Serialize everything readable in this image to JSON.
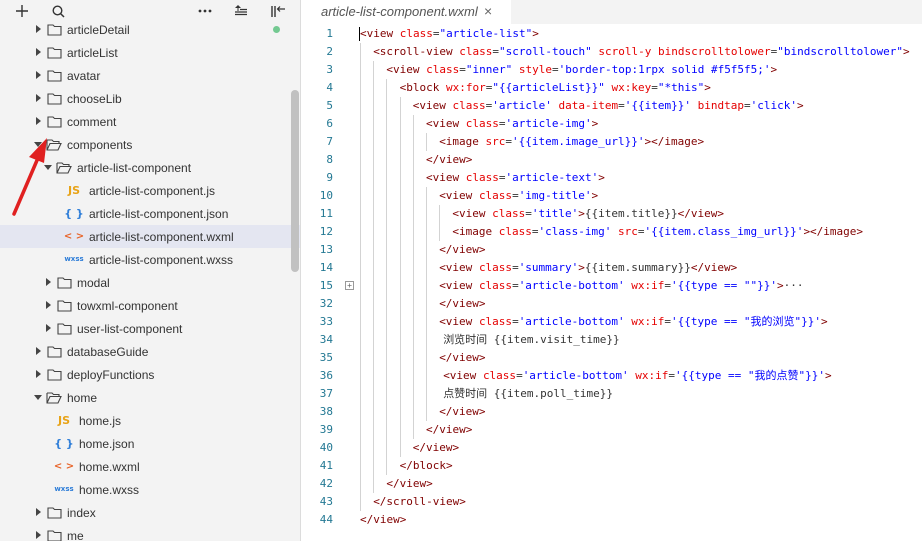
{
  "toolbar": {
    "add": "+",
    "search": "search-icon",
    "more": "···",
    "collapse": "collapse-icon",
    "split": "split-icon"
  },
  "tree": [
    {
      "label": "articleDetail",
      "type": "folder",
      "open": false,
      "depth": 0,
      "dot": true
    },
    {
      "label": "articleList",
      "type": "folder",
      "open": false,
      "depth": 0
    },
    {
      "label": "avatar",
      "type": "folder",
      "open": false,
      "depth": 0
    },
    {
      "label": "chooseLib",
      "type": "folder",
      "open": false,
      "depth": 0
    },
    {
      "label": "comment",
      "type": "folder",
      "open": false,
      "depth": 0
    },
    {
      "label": "components",
      "type": "folder",
      "open": true,
      "depth": 0
    },
    {
      "label": "article-list-component",
      "type": "folder",
      "open": true,
      "depth": 1
    },
    {
      "label": "article-list-component.js",
      "type": "js",
      "depth": 2,
      "icon": "JS"
    },
    {
      "label": "article-list-component.json",
      "type": "json",
      "depth": 2,
      "icon": "{ }"
    },
    {
      "label": "article-list-component.wxml",
      "type": "wxml",
      "depth": 2,
      "icon": "< >",
      "selected": true
    },
    {
      "label": "article-list-component.wxss",
      "type": "wxss",
      "depth": 2,
      "icon": "wxss"
    },
    {
      "label": "modal",
      "type": "folder",
      "open": false,
      "depth": 1
    },
    {
      "label": "towxml-component",
      "type": "folder",
      "open": false,
      "depth": 1
    },
    {
      "label": "user-list-component",
      "type": "folder",
      "open": false,
      "depth": 1
    },
    {
      "label": "databaseGuide",
      "type": "folder",
      "open": false,
      "depth": 0
    },
    {
      "label": "deployFunctions",
      "type": "folder",
      "open": false,
      "depth": 0
    },
    {
      "label": "home",
      "type": "folder",
      "open": true,
      "depth": 0
    },
    {
      "label": "home.js",
      "type": "js",
      "depth": 1,
      "icon": "JS"
    },
    {
      "label": "home.json",
      "type": "json",
      "depth": 1,
      "icon": "{ }"
    },
    {
      "label": "home.wxml",
      "type": "wxml",
      "depth": 1,
      "icon": "< >"
    },
    {
      "label": "home.wxss",
      "type": "wxss",
      "depth": 1,
      "icon": "wxss"
    },
    {
      "label": "index",
      "type": "folder",
      "open": false,
      "depth": 0
    },
    {
      "label": "me",
      "type": "folder",
      "open": false,
      "depth": 0
    }
  ],
  "editor": {
    "tab_title": "article-list-component.wxml",
    "tab_close": "×",
    "lines": [
      {
        "n": "1",
        "indent": 0,
        "tokens": [
          [
            "t",
            "<view "
          ],
          [
            "a",
            "class"
          ],
          [
            "p",
            "="
          ],
          [
            "v",
            "\"article-list\""
          ],
          [
            "t",
            ">"
          ]
        ]
      },
      {
        "n": "2",
        "indent": 1,
        "tokens": [
          [
            "t",
            "<scroll-view "
          ],
          [
            "a",
            "class"
          ],
          [
            "p",
            "="
          ],
          [
            "v",
            "\"scroll-touch\""
          ],
          [
            "p",
            " "
          ],
          [
            "a",
            "scroll-y"
          ],
          [
            "p",
            " "
          ],
          [
            "a",
            "bindscrolltolower"
          ],
          [
            "p",
            "="
          ],
          [
            "v",
            "\"bindscrolltolower\""
          ],
          [
            "t",
            ">"
          ]
        ]
      },
      {
        "n": "3",
        "indent": 2,
        "tokens": [
          [
            "t",
            "<view "
          ],
          [
            "a",
            "class"
          ],
          [
            "p",
            "="
          ],
          [
            "v",
            "\"inner\""
          ],
          [
            "p",
            " "
          ],
          [
            "a",
            "style"
          ],
          [
            "p",
            "="
          ],
          [
            "v",
            "'border-top:1rpx solid #f5f5f5;'"
          ],
          [
            "t",
            ">"
          ]
        ]
      },
      {
        "n": "4",
        "indent": 3,
        "tokens": [
          [
            "t",
            "<block "
          ],
          [
            "a",
            "wx:for"
          ],
          [
            "p",
            "="
          ],
          [
            "v",
            "\"{{articleList}}\""
          ],
          [
            "p",
            " "
          ],
          [
            "a",
            "wx:key"
          ],
          [
            "p",
            "="
          ],
          [
            "v",
            "\"*this\""
          ],
          [
            "t",
            ">"
          ]
        ]
      },
      {
        "n": "5",
        "indent": 4,
        "tokens": [
          [
            "t",
            "<view "
          ],
          [
            "a",
            "class"
          ],
          [
            "p",
            "="
          ],
          [
            "v",
            "'article'"
          ],
          [
            "p",
            " "
          ],
          [
            "a",
            "data-item"
          ],
          [
            "p",
            "="
          ],
          [
            "v",
            "'{{item}}'"
          ],
          [
            "p",
            " "
          ],
          [
            "a",
            "bindtap"
          ],
          [
            "p",
            "="
          ],
          [
            "v",
            "'click'"
          ],
          [
            "t",
            ">"
          ]
        ]
      },
      {
        "n": "6",
        "indent": 5,
        "tokens": [
          [
            "t",
            "<view "
          ],
          [
            "a",
            "class"
          ],
          [
            "p",
            "="
          ],
          [
            "v",
            "'article-img'"
          ],
          [
            "t",
            ">"
          ]
        ]
      },
      {
        "n": "7",
        "indent": 6,
        "tokens": [
          [
            "t",
            "<image "
          ],
          [
            "a",
            "src"
          ],
          [
            "p",
            "="
          ],
          [
            "v",
            "'{{item.image_url}}'"
          ],
          [
            "t",
            "></image>"
          ]
        ]
      },
      {
        "n": "8",
        "indent": 5,
        "tokens": [
          [
            "t",
            "</view>"
          ]
        ]
      },
      {
        "n": "9",
        "indent": 5,
        "tokens": [
          [
            "t",
            "<view "
          ],
          [
            "a",
            "class"
          ],
          [
            "p",
            "="
          ],
          [
            "v",
            "'article-text'"
          ],
          [
            "t",
            ">"
          ]
        ]
      },
      {
        "n": "10",
        "indent": 6,
        "tokens": [
          [
            "t",
            "<view "
          ],
          [
            "a",
            "class"
          ],
          [
            "p",
            "="
          ],
          [
            "v",
            "'img-title'"
          ],
          [
            "t",
            ">"
          ]
        ]
      },
      {
        "n": "11",
        "indent": 7,
        "tokens": [
          [
            "t",
            "<view "
          ],
          [
            "a",
            "class"
          ],
          [
            "p",
            "="
          ],
          [
            "v",
            "'title'"
          ],
          [
            "t",
            ">"
          ],
          [
            "p",
            "{{item.title}}"
          ],
          [
            "t",
            "</view>"
          ]
        ]
      },
      {
        "n": "12",
        "indent": 7,
        "tokens": [
          [
            "t",
            "<image "
          ],
          [
            "a",
            "class"
          ],
          [
            "p",
            "="
          ],
          [
            "v",
            "'class-img'"
          ],
          [
            "p",
            " "
          ],
          [
            "a",
            "src"
          ],
          [
            "p",
            "="
          ],
          [
            "v",
            "'{{item.class_img_url}}'"
          ],
          [
            "t",
            "></image>"
          ]
        ]
      },
      {
        "n": "13",
        "indent": 6,
        "tokens": [
          [
            "t",
            "</view>"
          ]
        ]
      },
      {
        "n": "14",
        "indent": 6,
        "tokens": [
          [
            "t",
            "<view "
          ],
          [
            "a",
            "class"
          ],
          [
            "p",
            "="
          ],
          [
            "v",
            "'summary'"
          ],
          [
            "t",
            ">"
          ],
          [
            "p",
            "{{item.summary}}"
          ],
          [
            "t",
            "</view>"
          ]
        ]
      },
      {
        "n": "15",
        "indent": 6,
        "fold": true,
        "tokens": [
          [
            "t",
            "<view "
          ],
          [
            "a",
            "class"
          ],
          [
            "p",
            "="
          ],
          [
            "v",
            "'article-bottom'"
          ],
          [
            "p",
            " "
          ],
          [
            "a",
            "wx:if"
          ],
          [
            "p",
            "="
          ],
          [
            "v",
            "'{{type == \"\"}}'"
          ],
          [
            "t",
            ">"
          ],
          [
            "p",
            "···"
          ]
        ]
      },
      {
        "n": "32",
        "indent": 6,
        "tokens": [
          [
            "t",
            "</view>"
          ]
        ]
      },
      {
        "n": "33",
        "indent": 6,
        "tokens": [
          [
            "t",
            "<view "
          ],
          [
            "a",
            "class"
          ],
          [
            "p",
            "="
          ],
          [
            "v",
            "'article-bottom'"
          ],
          [
            "p",
            " "
          ],
          [
            "a",
            "wx:if"
          ],
          [
            "p",
            "="
          ],
          [
            "v",
            "'{{type == \"我的浏览\"}}'"
          ],
          [
            "t",
            ">"
          ]
        ]
      },
      {
        "n": "34",
        "indent": 6,
        "extra": 4,
        "tokens": [
          [
            "p",
            "浏览时间 {{item.visit_time}}"
          ]
        ]
      },
      {
        "n": "35",
        "indent": 6,
        "tokens": [
          [
            "t",
            "</view>"
          ]
        ]
      },
      {
        "n": "36",
        "indent": 6,
        "extra": 4,
        "tokens": [
          [
            "t",
            "<view "
          ],
          [
            "a",
            "class"
          ],
          [
            "p",
            "="
          ],
          [
            "v",
            "'article-bottom'"
          ],
          [
            "p",
            " "
          ],
          [
            "a",
            "wx:if"
          ],
          [
            "p",
            "="
          ],
          [
            "v",
            "'{{type == \"我的点赞\"}}'"
          ],
          [
            "t",
            ">"
          ]
        ]
      },
      {
        "n": "37",
        "indent": 6,
        "extra": 4,
        "tokens": [
          [
            "p",
            "点赞时间 {{item.poll_time}}"
          ]
        ]
      },
      {
        "n": "38",
        "indent": 6,
        "tokens": [
          [
            "t",
            "</view>"
          ]
        ]
      },
      {
        "n": "39",
        "indent": 5,
        "tokens": [
          [
            "t",
            "</view>"
          ]
        ]
      },
      {
        "n": "40",
        "indent": 4,
        "tokens": [
          [
            "t",
            "</view>"
          ]
        ]
      },
      {
        "n": "41",
        "indent": 3,
        "tokens": [
          [
            "t",
            "</block>"
          ]
        ]
      },
      {
        "n": "42",
        "indent": 2,
        "tokens": [
          [
            "t",
            "</view>"
          ]
        ]
      },
      {
        "n": "43",
        "indent": 1,
        "tokens": [
          [
            "t",
            "</scroll-view>"
          ]
        ]
      },
      {
        "n": "44",
        "indent": 0,
        "tokens": [
          [
            "t",
            "</view>"
          ]
        ]
      }
    ]
  },
  "colors": {
    "annotation_arrow": "#e02020",
    "selected_row": "#e4e6f1",
    "tag": "#800000",
    "attr": "#e50000",
    "value": "#0000ff"
  }
}
